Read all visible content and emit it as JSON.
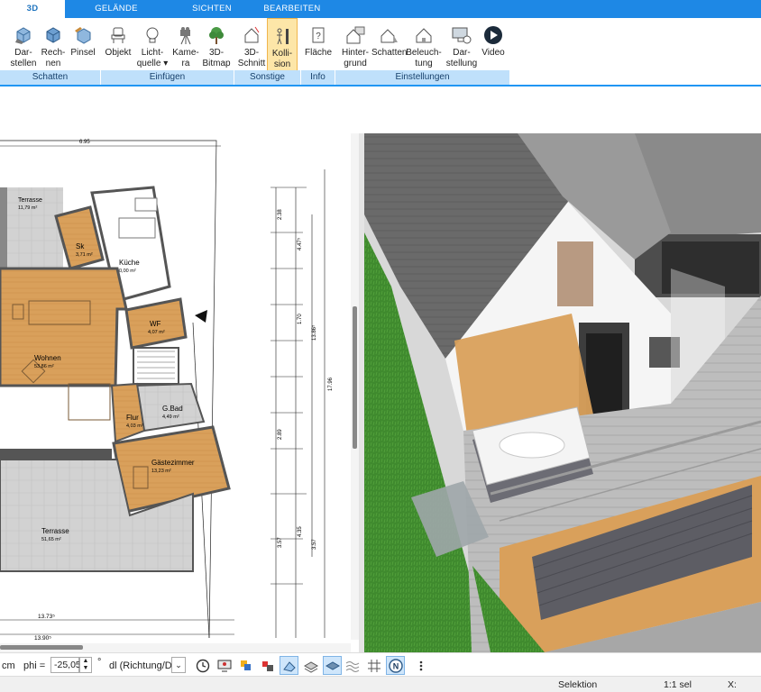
{
  "tabs": [
    {
      "label": "3D",
      "active": true
    },
    {
      "label": "GELÄNDE"
    },
    {
      "label": "SICHTEN"
    },
    {
      "label": "BEARBEITEN"
    }
  ],
  "ribbon": {
    "buttons": {
      "darstellen": "Dar-\nstellen",
      "rechnen": "Rech-\nnen",
      "pinsel": "Pinsel",
      "objekt": "Objekt",
      "lichtquelle": "Licht-\nquelle ▾",
      "kamera": "Kame-\nra",
      "bitmap3d": "3D-\nBitmap",
      "schnitt3d": "3D-\nSchnitt",
      "kollision": "Kolli-\nsion",
      "flaeche": "Fläche",
      "hintergrund": "Hinter-\ngrund",
      "schatten": "Schatten",
      "beleuchtung": "Beleuch-\ntung",
      "darstellung": "Dar-\nstellung",
      "video": "Video"
    },
    "groups": {
      "schatten": "Schatten",
      "einfuegen": "Einfügen",
      "sonstige": "Sonstige",
      "info": "Info",
      "einstellungen": "Einstellungen"
    }
  },
  "plan": {
    "rooms": {
      "terrasse_top": {
        "name": "Terrasse",
        "area": "11,79 m²"
      },
      "sk": {
        "name": "Sk",
        "area": "3,71 m²"
      },
      "kueche": {
        "name": "Küche",
        "area": "0,00 m²"
      },
      "wf": {
        "name": "WF",
        "area": "4,07 m²"
      },
      "wohnen": {
        "name": "Wohnen",
        "area": "53,86 m²"
      },
      "gbad": {
        "name": "G.Bad",
        "area": "4,49 m²"
      },
      "flur": {
        "name": "Flur",
        "area": "4,03 m²"
      },
      "gaestezimmer": {
        "name": "Gästezimmer",
        "area": "13,23 m²"
      },
      "terrasse_bottom": {
        "name": "Terrasse",
        "area": "51,65 m²"
      }
    },
    "dims": {
      "top": "6.95",
      "bottom1": "13.73⁵",
      "bottom2": "13.90⁵",
      "v1": "2.38",
      "v2": "4.47⁵",
      "v3": "1.70",
      "v4": "2.89",
      "v5": "3.57",
      "v6": "4.35",
      "v7": "3.57",
      "v8": "13.86⁵",
      "v9": "17.96"
    }
  },
  "toolbar": {
    "unit": "cm",
    "phi_label": "phi =",
    "phi_value": "-25,05",
    "deg": "°",
    "direction_value": "dl (Richtung/Di"
  },
  "status": {
    "mode": "Selektion",
    "scale": "1:1 sel",
    "x_label": "X:"
  },
  "colors": {
    "accent": "#1e88e5",
    "floor_wood": "#d9a05b",
    "terrace_gray": "#cfcfcf"
  }
}
